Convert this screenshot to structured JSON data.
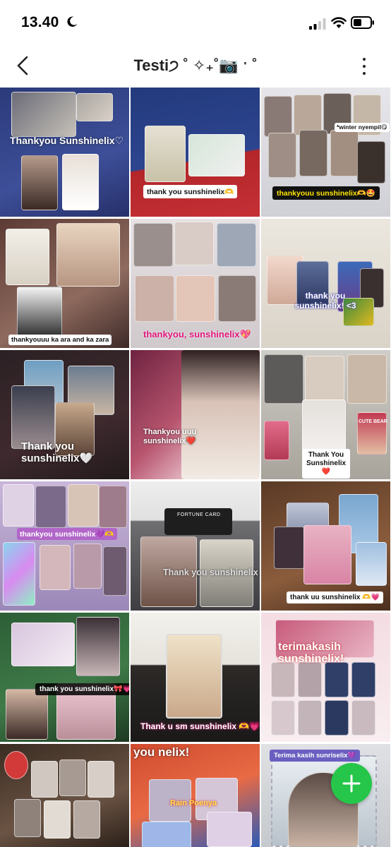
{
  "status_bar": {
    "time": "13.40",
    "icons": [
      "moon-icon",
      "signal-icon",
      "wifi-icon",
      "battery-icon"
    ]
  },
  "header": {
    "title": "Testi੭ ˚ ✧₊˚📷 ˑ ˚",
    "back_icon": "chevron-left-icon",
    "more_icon": "more-vertical-icon"
  },
  "grid": {
    "tiles": [
      {
        "caption": "Thankyou Sunshinelix♡"
      },
      {
        "caption": "thank you sunshinelix🫶"
      },
      {
        "caption": "thankyouu sunshinelix🫶🤩",
        "extra": "*winter nyempil😋"
      },
      {
        "caption": "thankyouuu ka ara and ka zara"
      },
      {
        "caption": "thankyou, sunshinelix💖"
      },
      {
        "caption": "thank you sunshinelix! <3"
      },
      {
        "caption": "Thank you sunshinelix🤍"
      },
      {
        "caption": "Thankyou uuu sunshinelix❤️"
      },
      {
        "caption": "Thank You Sunshinelix ❤️",
        "extra": "CUTE BEAR"
      },
      {
        "caption": "thankyou sunshinelix💜🫶"
      },
      {
        "caption": "Thank you sunshinelix",
        "extra": "FORTUNE CARD"
      },
      {
        "caption": "thank uu sunshinelix 🫶💗"
      },
      {
        "caption": "thank you sunshinelix🎀💗"
      },
      {
        "caption": "Thank u sm sunshinelix 🫶💗"
      },
      {
        "caption": "terimakasih sunshinelix!"
      },
      {
        "caption": ""
      },
      {
        "caption": "you nelix!",
        "extra": "Rain Poenya"
      },
      {
        "caption": "Terima kasih sunriselix💜"
      }
    ]
  },
  "fab": {
    "icon": "plus-icon",
    "color": "#26c64a"
  },
  "colors": {
    "accent": "#26c64a",
    "text": "#222222"
  }
}
